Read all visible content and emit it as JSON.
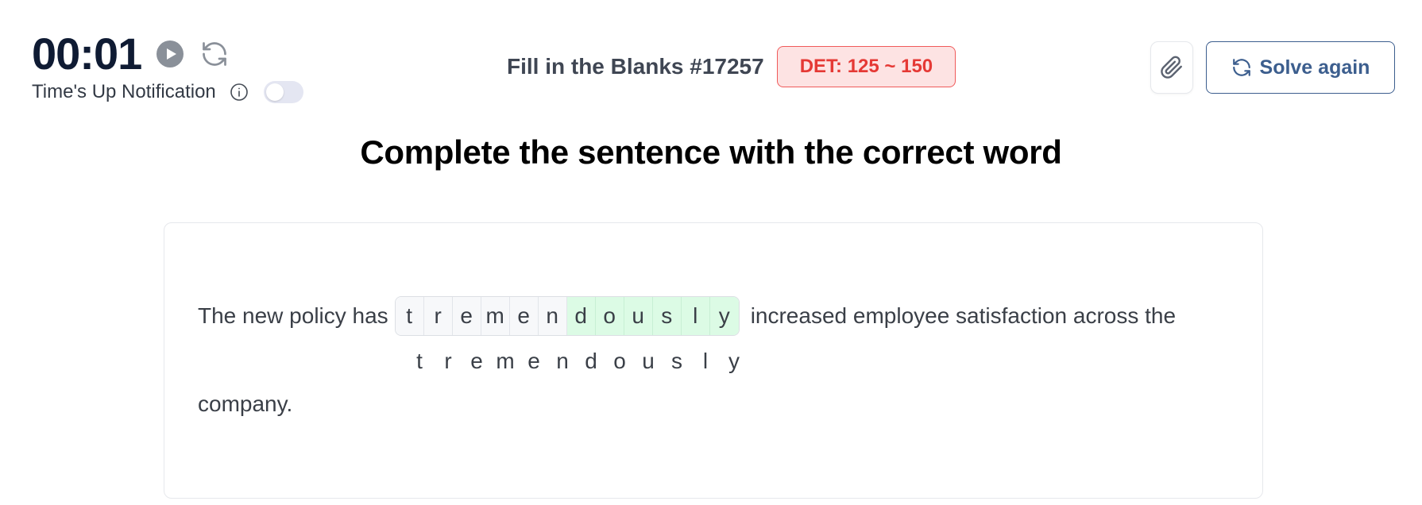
{
  "timer": {
    "value": "00:01",
    "play_icon": "play-icon",
    "reset_icon": "refresh-icon",
    "notification_label": "Time's Up Notification",
    "notification_enabled": false
  },
  "header": {
    "title": "Fill in the Blanks #17257",
    "badge": "DET: 125 ~ 150",
    "badge_color": "#e53935",
    "attach_icon": "paperclip-icon",
    "solve_again_label": "Solve again",
    "accent_color": "#3c5e8e"
  },
  "question": {
    "heading": "Complete the sentence with the correct word",
    "before": "The new policy has",
    "blank_letters": [
      "t",
      "r",
      "e",
      "m",
      "e",
      "n",
      "d",
      "o",
      "u",
      "s",
      "l",
      "y"
    ],
    "prefilled_count": 6,
    "after": "increased employee satisfaction across the",
    "answer_letters": [
      "t",
      "r",
      "e",
      "m",
      "e",
      "n",
      "d",
      "o",
      "u",
      "s",
      "l",
      "y"
    ],
    "continuation": "company."
  }
}
